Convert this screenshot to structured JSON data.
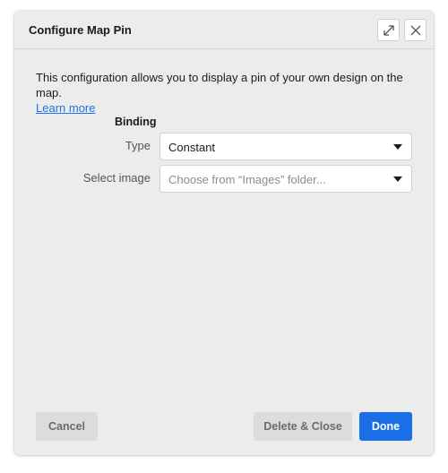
{
  "dialog": {
    "title": "Configure Map Pin",
    "expand_icon": "expand-icon",
    "close_icon": "close-icon"
  },
  "description": {
    "text": "This configuration allows you to display a pin of your own design on the map.",
    "link": "Learn more"
  },
  "binding": {
    "section_title": "Binding",
    "type_label": "Type",
    "type_value": "Constant",
    "image_label": "Select image",
    "image_placeholder": "Choose from “Images” folder..."
  },
  "footer": {
    "cancel": "Cancel",
    "delete_close": "Delete & Close",
    "done": "Done"
  },
  "colors": {
    "accent": "#1a6fe6",
    "link": "#1a73e8",
    "dialog_bg": "#ececec"
  }
}
